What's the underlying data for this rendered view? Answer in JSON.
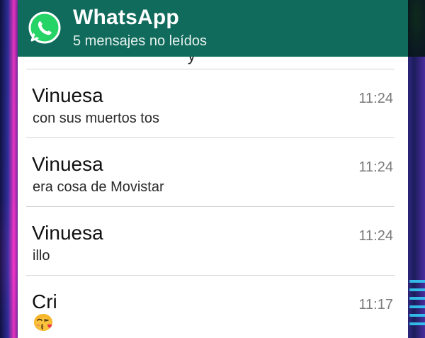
{
  "notification": {
    "app_name": "WhatsApp",
    "summary": "5 mensajes no leídos",
    "logo_icon": "whatsapp-logo-icon",
    "header_color": "#116b5c"
  },
  "messages": [
    {
      "sender": "Vinuesa",
      "time": "11:24",
      "text": "con sus muertos tos"
    },
    {
      "sender": "Vinuesa",
      "time": "11:24",
      "text": "era cosa de Movistar"
    },
    {
      "sender": "Vinuesa",
      "time": "11:24",
      "text": "illo"
    },
    {
      "sender": "Cri",
      "time": "11:17",
      "text": "",
      "emoji_icon": "face-blowing-kiss-emoji-icon"
    }
  ]
}
